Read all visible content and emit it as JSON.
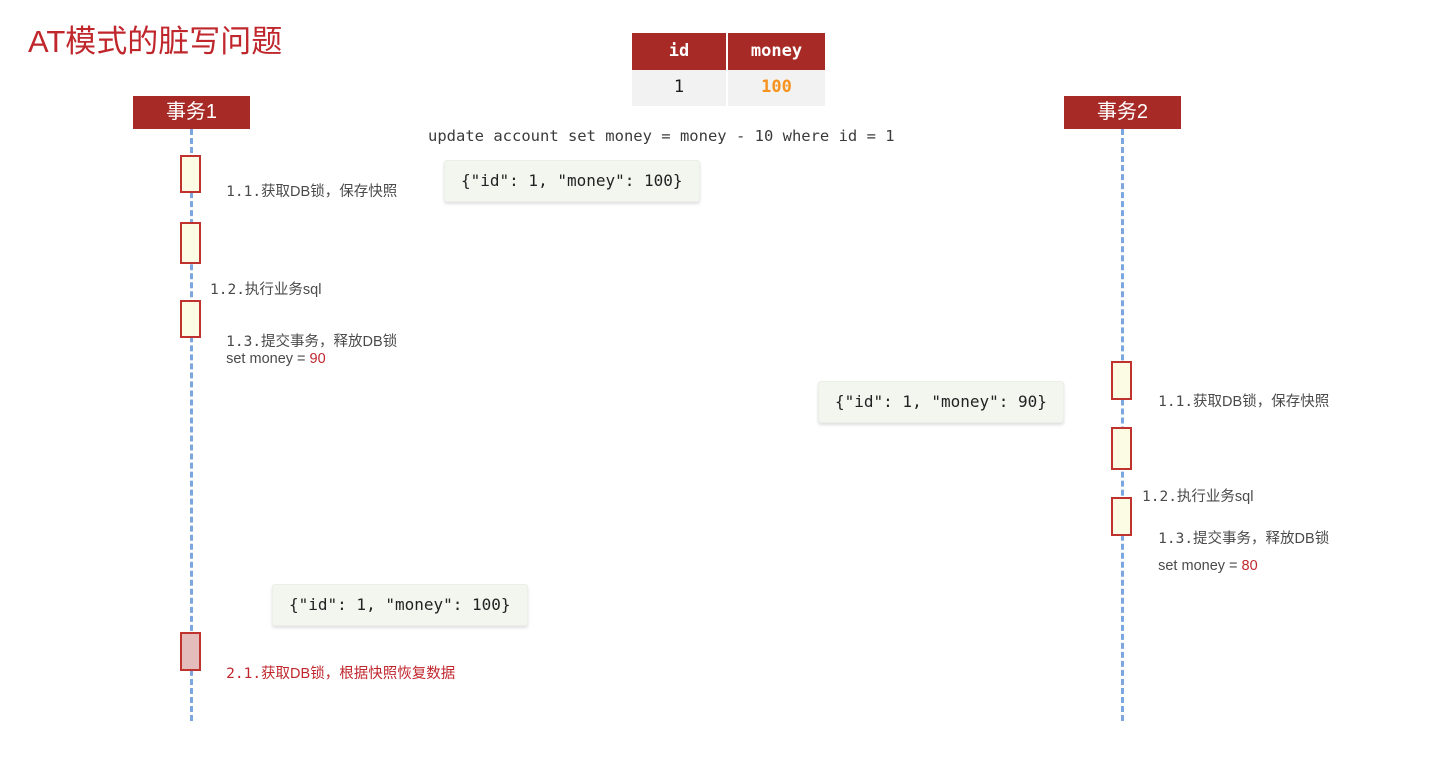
{
  "title": "AT模式的脏写问题",
  "colors": {
    "brand_red": "#a82a26",
    "title_red": "#c0272d",
    "lifeline_blue": "#6d9edb",
    "activation_fill": "#fcfbe3",
    "rollback_fill": "#e4bcbc",
    "money_orange": "#f5931e",
    "callout_bg": "#f3f6ef"
  },
  "table": {
    "headers": [
      "id",
      "money"
    ],
    "rows": [
      {
        "id": "1",
        "money": "100"
      }
    ]
  },
  "sql": "update account set money = money - 10 where id = 1",
  "actors": [
    {
      "id": "tx1",
      "label": "事务1"
    },
    {
      "id": "tx2",
      "label": "事务2"
    }
  ],
  "left_steps": [
    {
      "num": "1.1.",
      "text": "获取DB锁，保存快照",
      "sub": null,
      "sub_value": null,
      "danger": false
    },
    {
      "num": "1.2.",
      "text": "执行业务sql",
      "sub": "    set money = ",
      "sub_value": "90",
      "danger": false
    },
    {
      "num": "1.3.",
      "text": "提交事务，释放DB锁",
      "sub": null,
      "sub_value": null,
      "danger": false
    },
    {
      "num": "2.1.",
      "text": "获取DB锁，根据快照恢复数据",
      "sub": null,
      "sub_value": null,
      "danger": true
    }
  ],
  "right_steps": [
    {
      "num": "1.1.",
      "text": "获取DB锁，保存快照",
      "sub": null,
      "sub_value": null,
      "danger": false
    },
    {
      "num": "1.2.",
      "text": "执行业务sql",
      "sub": "    set money = ",
      "sub_value": "80",
      "danger": false
    },
    {
      "num": "1.3.",
      "text": "提交事务，释放DB锁",
      "sub": null,
      "sub_value": null,
      "danger": false
    }
  ],
  "callouts": [
    {
      "id": "snapshot-tx1",
      "text": "{\"id\": 1, \"money\": 100}"
    },
    {
      "id": "snapshot-tx2",
      "text": "{\"id\": 1, \"money\": 90}"
    },
    {
      "id": "restore-tx1",
      "text": "{\"id\": 1, \"money\": 100}"
    }
  ]
}
